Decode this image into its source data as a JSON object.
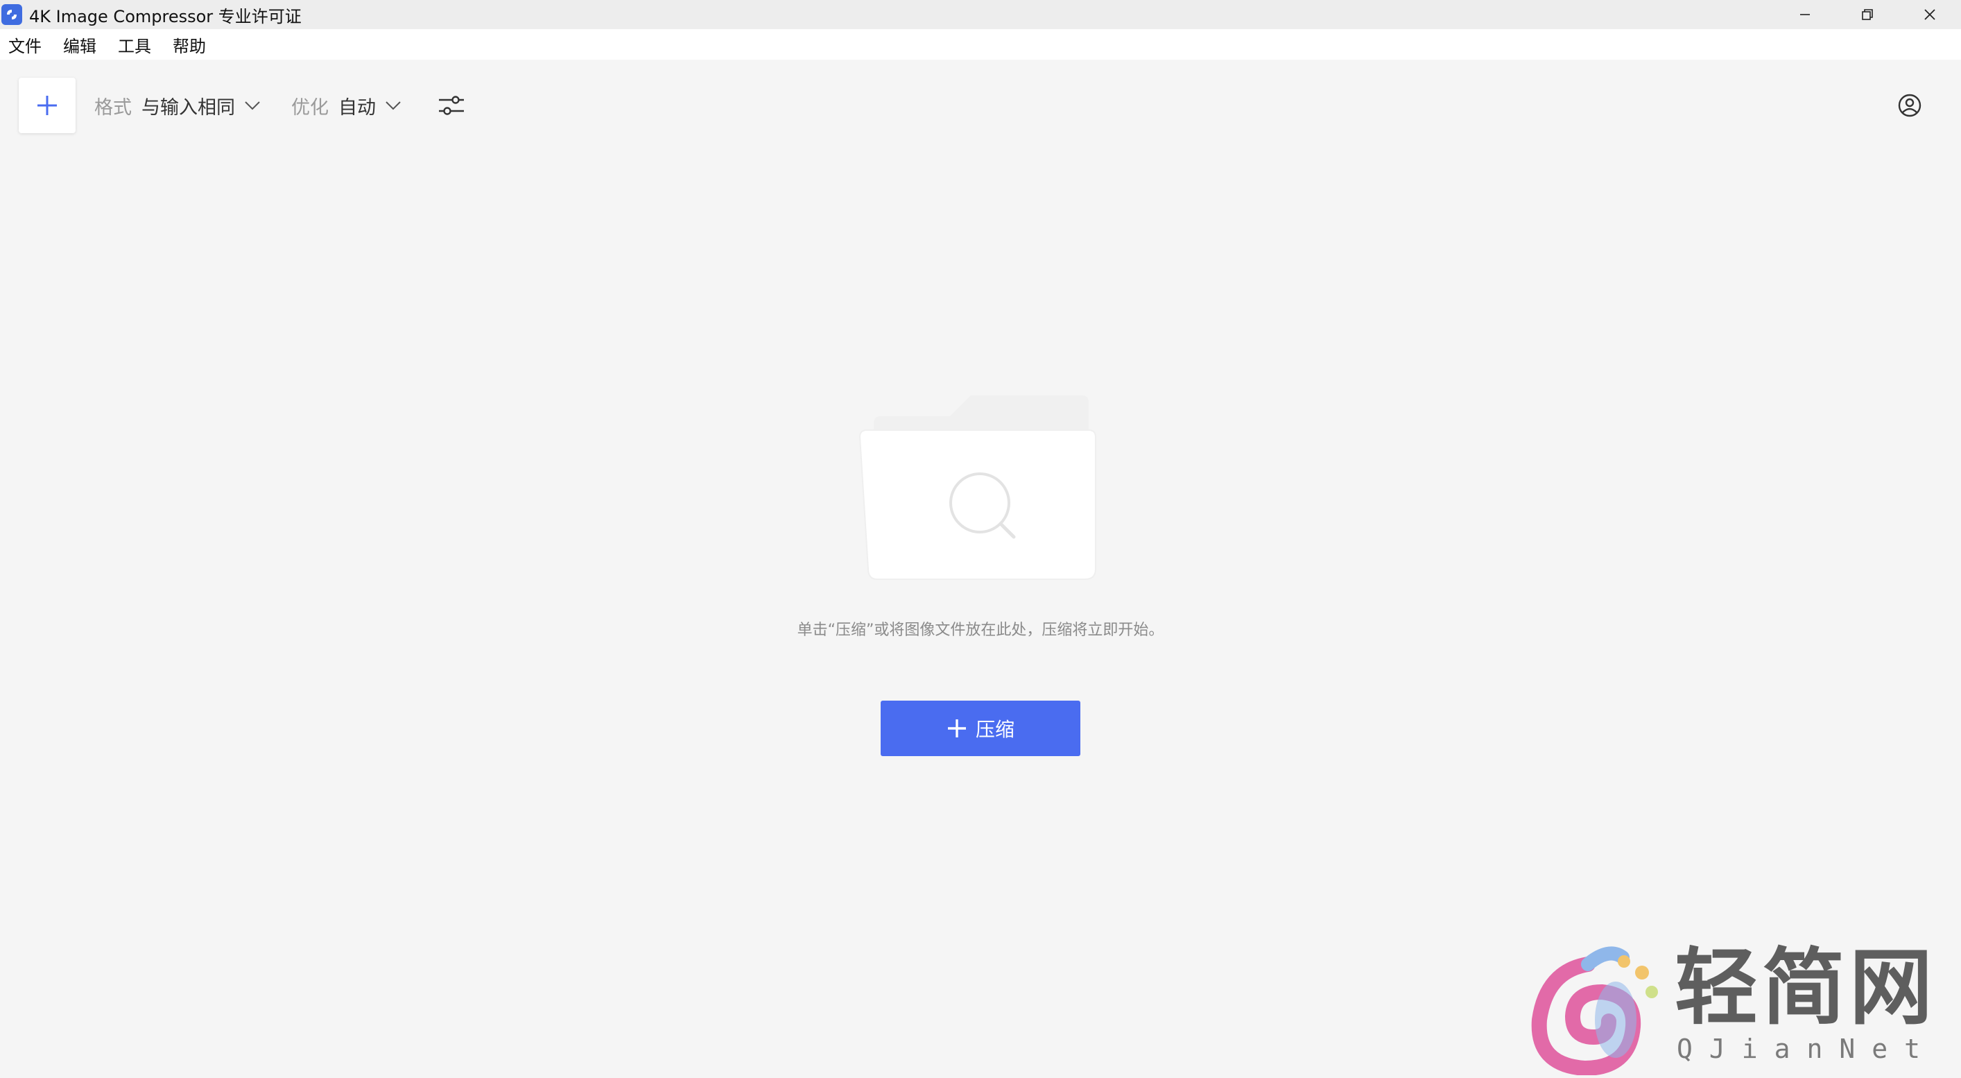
{
  "window": {
    "title": "4K Image Compressor 专业许可证",
    "controls": [
      "minimize-icon",
      "restore-icon",
      "close-icon"
    ]
  },
  "menubar": {
    "items": [
      {
        "label": "文件"
      },
      {
        "label": "编辑"
      },
      {
        "label": "工具"
      },
      {
        "label": "帮助"
      }
    ]
  },
  "toolbar": {
    "add_icon": "plus-icon",
    "format": {
      "label": "格式",
      "value": "与输入相同"
    },
    "optimize": {
      "label": "优化",
      "value": "自动"
    },
    "settings_icon": "sliders-icon",
    "account_icon": "user-circle-icon"
  },
  "empty_state": {
    "hint": "单击“压缩”或将图像文件放在此处，压缩将立即开始。",
    "button_label": "压缩",
    "illustration_icon": "folder-search-icon"
  },
  "watermark": {
    "text": "轻简网",
    "sub": "QJianNet"
  },
  "colors": {
    "accent": "#4a6cf0",
    "background": "#f5f5f5",
    "titlebar": "#ededed"
  }
}
